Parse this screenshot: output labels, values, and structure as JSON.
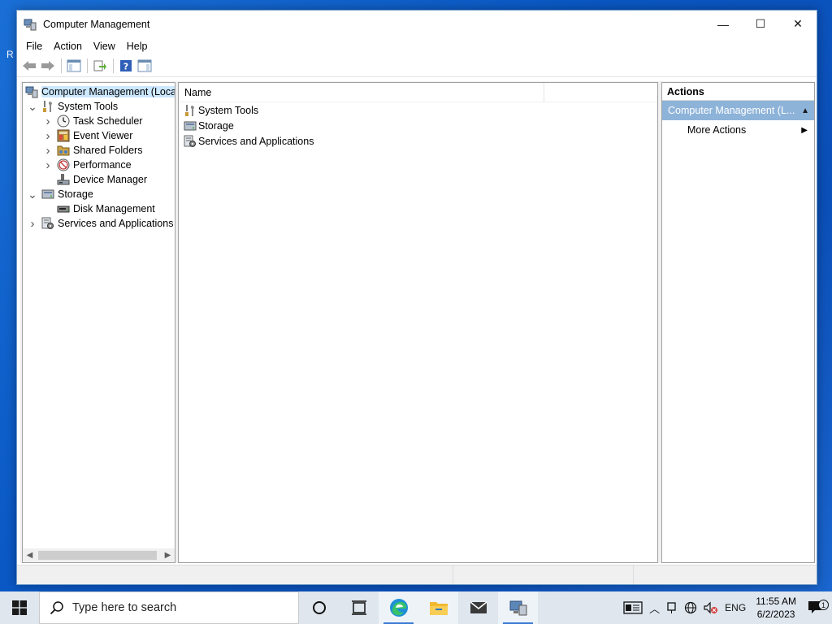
{
  "desktop": {
    "edge_letter": "R"
  },
  "window": {
    "title": "Computer Management",
    "controls": {
      "minimize": "—",
      "maximize": "☐",
      "close": "✕"
    }
  },
  "menu": [
    "File",
    "Action",
    "View",
    "Help"
  ],
  "tree": {
    "items": [
      {
        "label": "Computer Management (Local",
        "level": 0,
        "expander": "",
        "icon": "computer-management-icon",
        "selected": true
      },
      {
        "label": "System Tools",
        "level": 1,
        "expander": "v",
        "icon": "system-tools-icon"
      },
      {
        "label": "Task Scheduler",
        "level": 2,
        "expander": ">",
        "icon": "task-scheduler-icon"
      },
      {
        "label": "Event Viewer",
        "level": 2,
        "expander": ">",
        "icon": "event-viewer-icon"
      },
      {
        "label": "Shared Folders",
        "level": 2,
        "expander": ">",
        "icon": "shared-folders-icon"
      },
      {
        "label": "Performance",
        "level": 2,
        "expander": ">",
        "icon": "performance-icon"
      },
      {
        "label": "Device Manager",
        "level": 2,
        "expander": "",
        "icon": "device-manager-icon"
      },
      {
        "label": "Storage",
        "level": 1,
        "expander": "v",
        "icon": "storage-icon"
      },
      {
        "label": "Disk Management",
        "level": 2,
        "expander": "",
        "icon": "disk-management-icon"
      },
      {
        "label": "Services and Applications",
        "level": 1,
        "expander": ">",
        "icon": "services-applications-icon"
      }
    ]
  },
  "list": {
    "column_name": "Name",
    "rows": [
      {
        "label": "System Tools",
        "icon": "system-tools-icon"
      },
      {
        "label": "Storage",
        "icon": "storage-icon"
      },
      {
        "label": "Services and Applications",
        "icon": "services-applications-icon"
      }
    ]
  },
  "actions": {
    "header": "Actions",
    "group": "Computer Management (L...",
    "items": [
      "More Actions"
    ]
  },
  "taskbar": {
    "search_placeholder": "Type here to search",
    "tray": {
      "language": "ENG",
      "time": "11:55 AM",
      "date": "6/2/2023",
      "notifications": "1"
    }
  },
  "colors": {
    "selection": "#cce8ff",
    "actions_group_bg": "#8eb3d9",
    "taskbar_bg": "#dfe6ee"
  }
}
